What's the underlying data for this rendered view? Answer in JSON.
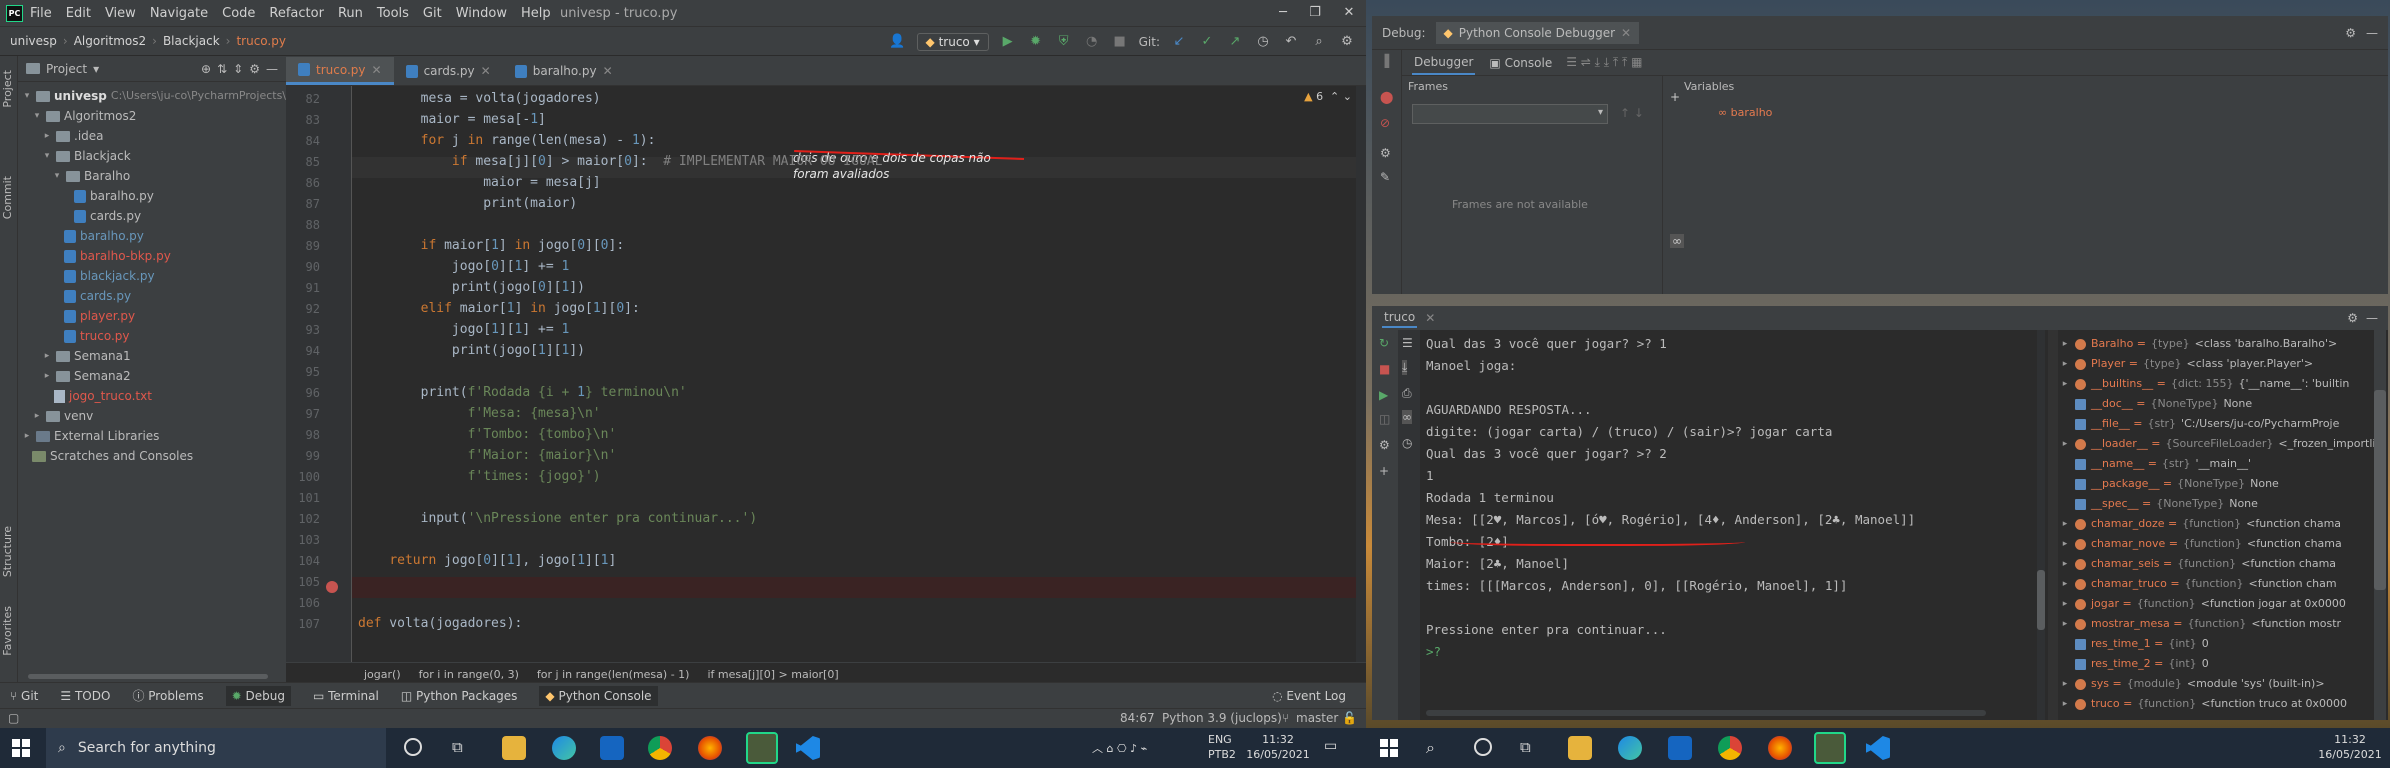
{
  "pycharm": {
    "menu": [
      "File",
      "Edit",
      "View",
      "Navigate",
      "Code",
      "Refactor",
      "Run",
      "Tools",
      "Git",
      "Window",
      "Help"
    ],
    "window_title": "univesp - truco.py",
    "breadcrumbs": [
      "univesp",
      "Algoritmos2",
      "Blackjack",
      "truco.py"
    ],
    "run_config": "truco",
    "git_label": "Git:",
    "project_label": "Project",
    "tree": [
      {
        "label": "univesp",
        "note": "C:\\Users\\ju-co\\PycharmProjects\\"
      },
      {
        "label": "Algoritmos2"
      },
      {
        "label": ".idea"
      },
      {
        "label": "Blackjack"
      },
      {
        "label": "Baralho"
      },
      {
        "label": "baralho.py"
      },
      {
        "label": "cards.py"
      },
      {
        "label": "baralho.py"
      },
      {
        "label": "baralho-bkp.py"
      },
      {
        "label": "blackjack.py"
      },
      {
        "label": "cards.py"
      },
      {
        "label": "player.py"
      },
      {
        "label": "truco.py"
      },
      {
        "label": "Semana1"
      },
      {
        "label": "Semana2"
      },
      {
        "label": "jogo_truco.txt"
      },
      {
        "label": "venv"
      },
      {
        "label": "External Libraries"
      },
      {
        "label": "Scratches and Consoles"
      }
    ],
    "tabs": [
      "truco.py",
      "cards.py",
      "baralho.py"
    ],
    "warnings": "6",
    "annotation": "dois de ouro e dois de copas não foram avaliados",
    "code_breadcrumbs": [
      "jogar()",
      "for i in range(0, 3)",
      "for j in range(len(mesa) - 1)",
      "if mesa[j][0] > maior[0]"
    ],
    "tool_windows": [
      "Git",
      "TODO",
      "Problems",
      "Debug",
      "Terminal",
      "Python Packages",
      "Python Console"
    ],
    "event_log": "Event Log",
    "status": {
      "position": "84:67",
      "interpreter": "Python 3.9 (juclops)",
      "branch": "master"
    },
    "left_strip": [
      "Project",
      "Commit",
      "Structure",
      "Favorites"
    ]
  },
  "code_lines": [
    {
      "n": "82",
      "t": "        mesa = volta(jogadores)"
    },
    {
      "n": "83",
      "t": "        maior = mesa[-1]"
    },
    {
      "n": "84",
      "t": "        for j in range(len(mesa) - 1):"
    },
    {
      "n": "85",
      "t": "            if mesa[j][0] > maior[0]:  # IMPLEMENTAR MAIOR OU IGUAL"
    },
    {
      "n": "86",
      "t": "                maior = mesa[j]"
    },
    {
      "n": "87",
      "t": "                print(maior)"
    },
    {
      "n": "88",
      "t": ""
    },
    {
      "n": "89",
      "t": "        if maior[1] in jogo[0][0]:"
    },
    {
      "n": "90",
      "t": "            jogo[0][1] += 1"
    },
    {
      "n": "91",
      "t": "            print(jogo[0][1])"
    },
    {
      "n": "92",
      "t": "        elif maior[1] in jogo[1][0]:"
    },
    {
      "n": "93",
      "t": "            jogo[1][1] += 1"
    },
    {
      "n": "94",
      "t": "            print(jogo[1][1])"
    },
    {
      "n": "95",
      "t": ""
    },
    {
      "n": "96",
      "t": "        print(f'Rodada {i + 1} terminou\\n'"
    },
    {
      "n": "97",
      "t": "              f'Mesa: {mesa}\\n'"
    },
    {
      "n": "98",
      "t": "              f'Tombo: {tombo}\\n'"
    },
    {
      "n": "99",
      "t": "              f'Maior: {maior}\\n'"
    },
    {
      "n": "100",
      "t": "              f'times: {jogo}')"
    },
    {
      "n": "101",
      "t": ""
    },
    {
      "n": "102",
      "t": "        input('\\nPressione enter pra continuar...')"
    },
    {
      "n": "103",
      "t": ""
    },
    {
      "n": "104",
      "t": "    return jogo[0][1], jogo[1][1]"
    },
    {
      "n": "105",
      "t": ""
    },
    {
      "n": "106",
      "t": ""
    },
    {
      "n": "107",
      "t": "def volta(jogadores):"
    }
  ],
  "debugger": {
    "title": "Debug:",
    "tab": "Python Console Debugger",
    "subtabs": [
      "Debugger",
      "Console"
    ],
    "frames_label": "Frames",
    "variables_label": "Variables",
    "frames_empty": "Frames are not available",
    "variable": "baralho"
  },
  "console": {
    "title": "truco",
    "lines": [
      "Qual das 3 você quer jogar? >? 1",
      "Manoel joga:",
      "",
      "AGUARDANDO RESPOSTA...",
      "digite: (jogar carta) / (truco) / (sair)>? jogar carta",
      "Qual das 3 você quer jogar? >? 2",
      "1",
      "Rodada 1 terminou",
      "Mesa: [[2♥, Marcos], [ó♥, Rogério], [4♦, Anderson], [2♣, Manoel]]",
      "Tombo: [2♦]",
      "Maior: [2♣, Manoel]",
      "times: [[[Marcos, Anderson], 0], [[Rogério, Manoel], 1]]",
      "",
      "Pressione enter pra continuar...",
      ">?"
    ],
    "variables": [
      {
        "name": "Baralho",
        "type": "{type}",
        "val": "<class 'baralho.Baralho'>"
      },
      {
        "name": "Player",
        "type": "{type}",
        "val": "<class 'player.Player'>"
      },
      {
        "name": "__builtins__",
        "type": "{dict: 155}",
        "val": "{'__name__': 'builtin"
      },
      {
        "name": "__doc__",
        "type": "{NoneType}",
        "val": "None"
      },
      {
        "name": "__file__",
        "type": "{str}",
        "val": "'C:/Users/ju-co/PycharmProje"
      },
      {
        "name": "__loader__",
        "type": "{SourceFileLoader}",
        "val": "<_frozen_importlib"
      },
      {
        "name": "__name__",
        "type": "{str}",
        "val": "'__main__'"
      },
      {
        "name": "__package__",
        "type": "{NoneType}",
        "val": "None"
      },
      {
        "name": "__spec__",
        "type": "{NoneType}",
        "val": "None"
      },
      {
        "name": "chamar_doze",
        "type": "{function}",
        "val": "<function chama"
      },
      {
        "name": "chamar_nove",
        "type": "{function}",
        "val": "<function chama"
      },
      {
        "name": "chamar_seis",
        "type": "{function}",
        "val": "<function chama"
      },
      {
        "name": "chamar_truco",
        "type": "{function}",
        "val": "<function cham"
      },
      {
        "name": "jogar",
        "type": "{function}",
        "val": "<function jogar at 0x0000"
      },
      {
        "name": "mostrar_mesa",
        "type": "{function}",
        "val": "<function mostr"
      },
      {
        "name": "res_time_1",
        "type": "{int}",
        "val": "0"
      },
      {
        "name": "res_time_2",
        "type": "{int}",
        "val": "0"
      },
      {
        "name": "sys",
        "type": "{module}",
        "val": "<module 'sys' (built-in)>"
      },
      {
        "name": "truco",
        "type": "{function}",
        "val": "<function truco at 0x0000"
      }
    ]
  },
  "taskbar": {
    "search": "Search for anything",
    "lang": "ENG",
    "layout": "PTB2",
    "time": "11:32",
    "date": "16/05/2021",
    "time2": "11:32",
    "date2": "16/05/2021"
  },
  "colors": {
    "accent": "#4a88c7",
    "keyword": "#cc7832",
    "string": "#6a8759",
    "annotation_red": "#e0201a"
  }
}
